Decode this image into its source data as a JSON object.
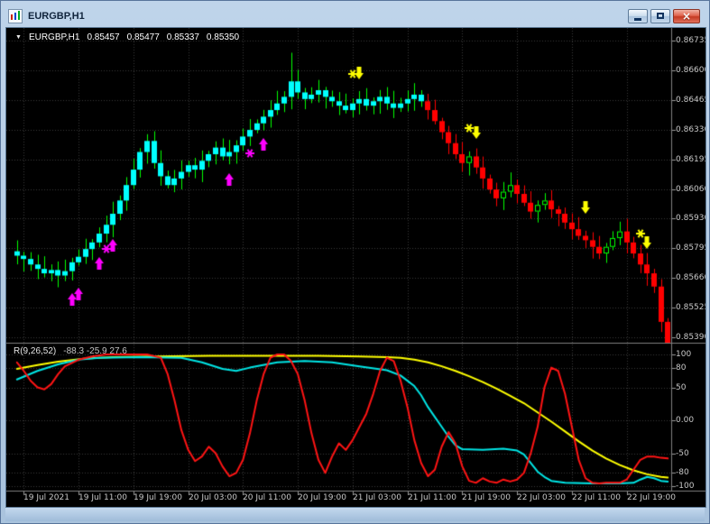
{
  "window": {
    "title": "EURGBP,H1",
    "collapse_glyph": "▼",
    "close_glyph": "×"
  },
  "header": {
    "symbol_period": "EURGBP,H1",
    "open": "0.85457",
    "high": "0.85477",
    "low": "0.85337",
    "close": "0.85350"
  },
  "oscillator_header": {
    "name": "R(9,26,52)",
    "values": "-88.3 -25.9 27.6"
  },
  "chart_data": {
    "type": "candlestick",
    "title": "EURGBP,H1",
    "price_scale": [
      "0.86735",
      "0.86600",
      "0.86465",
      "0.86330",
      "0.86195",
      "0.86060",
      "0.85930",
      "0.85795",
      "0.85660",
      "0.85525",
      "0.85390"
    ],
    "time_scale": [
      "19 Jul 2021",
      "19 Jul 11:00",
      "19 Jul 19:00",
      "20 Jul 03:00",
      "20 Jul 11:00",
      "20 Jul 19:00",
      "21 Jul 03:00",
      "21 Jul 11:00",
      "21 Jul 19:00",
      "22 Jul 03:00",
      "22 Jul 11:00",
      "22 Jul 19:00"
    ],
    "candles": {
      "first_open": 0.8578,
      "closes": [
        0.8576,
        0.85745,
        0.8572,
        0.857,
        0.8568,
        0.85695,
        0.8567,
        0.8569,
        0.8573,
        0.85755,
        0.8579,
        0.8582,
        0.8586,
        0.859,
        0.8595,
        0.8601,
        0.8608,
        0.8615,
        0.8623,
        0.8628,
        0.8618,
        0.8612,
        0.8608,
        0.8611,
        0.8614,
        0.8617,
        0.8615,
        0.8619,
        0.8622,
        0.8625,
        0.8621,
        0.8623,
        0.8626,
        0.863,
        0.8633,
        0.8636,
        0.8639,
        0.8642,
        0.8645,
        0.8648,
        0.8655,
        0.865,
        0.8647,
        0.8649,
        0.8651,
        0.8648,
        0.8646,
        0.8644,
        0.8642,
        0.8645,
        0.8647,
        0.8644,
        0.8646,
        0.8648,
        0.8645,
        0.8643,
        0.8645,
        0.8647,
        0.8649,
        0.8646,
        0.8642,
        0.8637,
        0.8632,
        0.8627,
        0.8622,
        0.8618,
        0.8621,
        0.8616,
        0.8611,
        0.8606,
        0.8602,
        0.8605,
        0.8608,
        0.8604,
        0.86,
        0.8596,
        0.8599,
        0.8601,
        0.8597,
        0.8595,
        0.8591,
        0.8588,
        0.8585,
        0.8583,
        0.858,
        0.8577,
        0.858,
        0.8584,
        0.8587,
        0.8582,
        0.8577,
        0.8572,
        0.8568,
        0.8562,
        0.8546,
        0.8535
      ],
      "high_overrides": {
        "40": 0.8668,
        "95": 0.85477
      },
      "low_overrides": {
        "95": 0.85337
      }
    },
    "trend_segments": [
      {
        "from": 0,
        "to": 59,
        "dir": "up"
      },
      {
        "from": 60,
        "to": 95,
        "dir": "down"
      }
    ],
    "signals": {
      "up_arrows": [
        {
          "i": 8,
          "price": 0.8559
        },
        {
          "i": 9,
          "price": 0.85615
        },
        {
          "i": 12,
          "price": 0.85755
        },
        {
          "i": 14,
          "price": 0.85835
        },
        {
          "i": 31,
          "price": 0.86135
        },
        {
          "i": 36,
          "price": 0.86295
        }
      ],
      "up_stars": [
        {
          "i": 13,
          "price": 0.8579
        },
        {
          "i": 34,
          "price": 0.86225
        }
      ],
      "down_arrows": [
        {
          "i": 50,
          "price": 0.8656
        },
        {
          "i": 67,
          "price": 0.8629
        },
        {
          "i": 83,
          "price": 0.8595
        },
        {
          "i": 92,
          "price": 0.8579
        }
      ],
      "down_stars": [
        {
          "i": 49,
          "price": 0.86585
        },
        {
          "i": 66,
          "price": 0.8634
        },
        {
          "i": 91,
          "price": 0.8586
        }
      ]
    },
    "oscillator": {
      "label": "R(9,26,52)",
      "values_text": "-88.3 -25.9 27.6",
      "range": [
        -100,
        100
      ],
      "scale": [
        "100",
        "80",
        "50",
        "0.00",
        "-50",
        "-80",
        "-100"
      ],
      "scale_values": [
        100,
        80,
        50,
        0,
        -50,
        -80,
        -100
      ],
      "series": [
        {
          "name": "slow",
          "color": "#ffff00",
          "points": [
            [
              0,
              78
            ],
            [
              3,
              84
            ],
            [
              6,
              89
            ],
            [
              10,
              94
            ],
            [
              14,
              96
            ],
            [
              20,
              97
            ],
            [
              28,
              98
            ],
            [
              36,
              98
            ],
            [
              44,
              98
            ],
            [
              50,
              97
            ],
            [
              54,
              96
            ],
            [
              56,
              95
            ],
            [
              58,
              92
            ],
            [
              60,
              88
            ],
            [
              62,
              82
            ],
            [
              64,
              75
            ],
            [
              66,
              67
            ],
            [
              68,
              58
            ],
            [
              70,
              48
            ],
            [
              72,
              37
            ],
            [
              74,
              26
            ],
            [
              76,
              12
            ],
            [
              78,
              -2
            ],
            [
              80,
              -17
            ],
            [
              82,
              -32
            ],
            [
              84,
              -46
            ],
            [
              86,
              -58
            ],
            [
              88,
              -68
            ],
            [
              90,
              -76
            ],
            [
              92,
              -82
            ],
            [
              94,
              -86
            ],
            [
              95,
              -87
            ]
          ]
        },
        {
          "name": "mid",
          "color": "#00e5e5",
          "points": [
            [
              0,
              62
            ],
            [
              3,
              75
            ],
            [
              6,
              85
            ],
            [
              9,
              92
            ],
            [
              12,
              95
            ],
            [
              18,
              96
            ],
            [
              24,
              95
            ],
            [
              27,
              88
            ],
            [
              30,
              78
            ],
            [
              32,
              75
            ],
            [
              34,
              80
            ],
            [
              38,
              88
            ],
            [
              42,
              90
            ],
            [
              46,
              88
            ],
            [
              50,
              82
            ],
            [
              54,
              76
            ],
            [
              56,
              68
            ],
            [
              58,
              52
            ],
            [
              59,
              38
            ],
            [
              60,
              20
            ],
            [
              61,
              5
            ],
            [
              62,
              -10
            ],
            [
              63,
              -25
            ],
            [
              64,
              -38
            ],
            [
              65,
              -44
            ],
            [
              68,
              -45
            ],
            [
              71,
              -43
            ],
            [
              73,
              -46
            ],
            [
              74,
              -52
            ],
            [
              75,
              -65
            ],
            [
              76,
              -78
            ],
            [
              77,
              -86
            ],
            [
              78,
              -92
            ],
            [
              80,
              -95
            ],
            [
              84,
              -96
            ],
            [
              88,
              -96
            ],
            [
              90,
              -95
            ],
            [
              91,
              -90
            ],
            [
              92,
              -86
            ],
            [
              93,
              -88
            ],
            [
              94,
              -92
            ],
            [
              95,
              -93
            ]
          ]
        },
        {
          "name": "fast",
          "color": "#ff1414",
          "points": [
            [
              0,
              88
            ],
            [
              1,
              75
            ],
            [
              2,
              60
            ],
            [
              3,
              50
            ],
            [
              4,
              47
            ],
            [
              5,
              55
            ],
            [
              6,
              70
            ],
            [
              7,
              82
            ],
            [
              9,
              92
            ],
            [
              11,
              97
            ],
            [
              13,
              100
            ],
            [
              19,
              100
            ],
            [
              21,
              95
            ],
            [
              22,
              70
            ],
            [
              23,
              30
            ],
            [
              24,
              -15
            ],
            [
              25,
              -45
            ],
            [
              26,
              -62
            ],
            [
              27,
              -55
            ],
            [
              28,
              -40
            ],
            [
              29,
              -50
            ],
            [
              30,
              -70
            ],
            [
              31,
              -85
            ],
            [
              32,
              -80
            ],
            [
              33,
              -60
            ],
            [
              34,
              -20
            ],
            [
              35,
              30
            ],
            [
              36,
              70
            ],
            [
              37,
              95
            ],
            [
              38,
              100
            ],
            [
              39,
              100
            ],
            [
              40,
              90
            ],
            [
              41,
              70
            ],
            [
              42,
              30
            ],
            [
              43,
              -20
            ],
            [
              44,
              -60
            ],
            [
              45,
              -80
            ],
            [
              46,
              -55
            ],
            [
              47,
              -35
            ],
            [
              48,
              -45
            ],
            [
              49,
              -30
            ],
            [
              50,
              -10
            ],
            [
              51,
              10
            ],
            [
              52,
              40
            ],
            [
              53,
              75
            ],
            [
              54,
              95
            ],
            [
              55,
              90
            ],
            [
              56,
              60
            ],
            [
              57,
              20
            ],
            [
              58,
              -30
            ],
            [
              59,
              -65
            ],
            [
              60,
              -85
            ],
            [
              61,
              -75
            ],
            [
              62,
              -40
            ],
            [
              63,
              -18
            ],
            [
              64,
              -35
            ],
            [
              65,
              -70
            ],
            [
              66,
              -92
            ],
            [
              67,
              -95
            ],
            [
              68,
              -88
            ],
            [
              69,
              -93
            ],
            [
              70,
              -95
            ],
            [
              71,
              -90
            ],
            [
              72,
              -93
            ],
            [
              73,
              -90
            ],
            [
              74,
              -80
            ],
            [
              75,
              -50
            ],
            [
              76,
              -10
            ],
            [
              77,
              50
            ],
            [
              78,
              80
            ],
            [
              79,
              75
            ],
            [
              80,
              40
            ],
            [
              81,
              -10
            ],
            [
              82,
              -60
            ],
            [
              83,
              -88
            ],
            [
              84,
              -95
            ],
            [
              85,
              -96
            ],
            [
              86,
              -95
            ],
            [
              87,
              -95
            ],
            [
              88,
              -95
            ],
            [
              89,
              -90
            ],
            [
              90,
              -75
            ],
            [
              91,
              -60
            ],
            [
              92,
              -55
            ],
            [
              93,
              -55
            ],
            [
              94,
              -57
            ],
            [
              95,
              -58
            ]
          ]
        }
      ]
    },
    "colors": {
      "bg": "#000000",
      "grid": "#3a3a3a",
      "candle": "#00ff00",
      "up_bar": "#00ffff",
      "down_bar": "#ff0000",
      "arrow_up": "#ff00ff",
      "arrow_down": "#ffff00",
      "separator": "#808080",
      "scale_text": "#c8c8c8"
    }
  }
}
